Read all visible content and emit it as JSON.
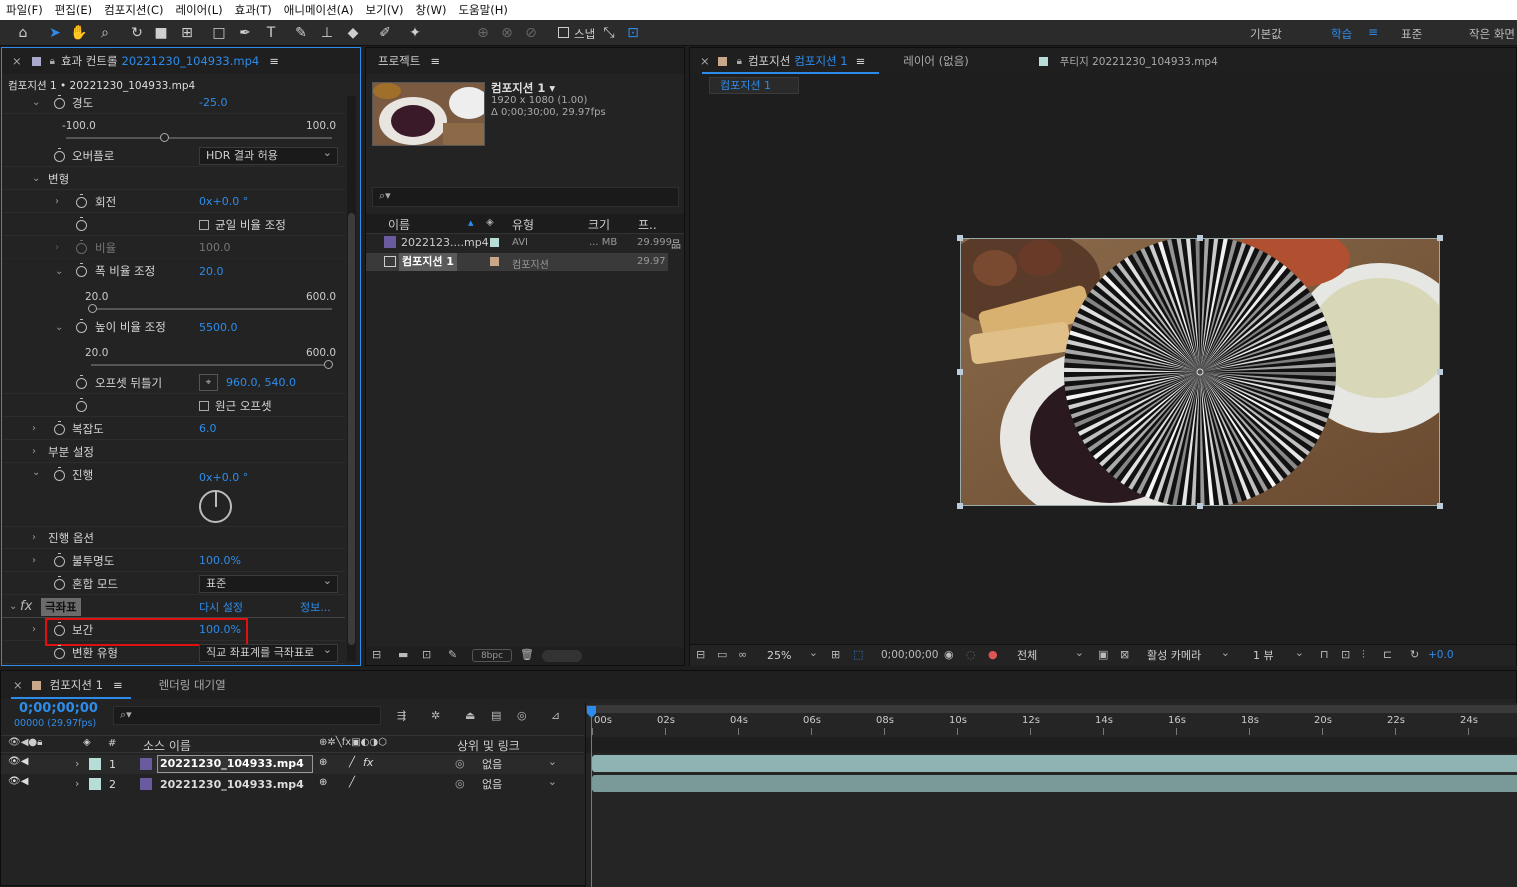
{
  "menu": [
    "파일(F)",
    "편집(E)",
    "컴포지션(C)",
    "레이어(L)",
    "효과(T)",
    "애니메이션(A)",
    "보기(V)",
    "창(W)",
    "도움말(H)"
  ],
  "toolbar": {
    "snap_label": "스냅",
    "workspaces": [
      "기본값",
      "학습",
      "표준",
      "작은 화면"
    ]
  },
  "effects": {
    "tab_title": "효과 컨트롤",
    "tab_file": "20221230_104933.mp4",
    "breadcrumb": "컴포지션 1 • 20221230_104933.mp4",
    "props": {
      "kyungdo": "경도",
      "kyungdo_val": "-25.0",
      "kyungdo_min": "-100.0",
      "kyungdo_max": "100.0",
      "overflow": "오버플로",
      "overflow_val": "HDR 결과 허용",
      "transform": "변형",
      "rotation": "회전",
      "rotation_val": "0x+0.0 °",
      "uniform": "균일 비율 조정",
      "ratio": "비율",
      "ratio_val": "100.0",
      "width_scale": "폭 비율 조정",
      "width_val": "20.0",
      "width_min": "20.0",
      "width_max": "600.0",
      "height_scale": "높이 비율 조정",
      "height_val": "5500.0",
      "height_min": "20.0",
      "height_max": "600.0",
      "offset": "오프셋 뒤틀기",
      "offset_val": "960.0, 540.0",
      "orig_offset": "원근 오프셋",
      "complexity": "복잡도",
      "complexity_val": "6.0",
      "sub": "부분 설정",
      "evolution": "진행",
      "evolution_val": "0x+0.0 °",
      "evo_opt": "진행 옵션",
      "opacity": "불투명도",
      "opacity_val": "100.0%",
      "blend": "혼합 모드",
      "blend_val": "표준",
      "fx_name": "극좌표",
      "reset": "다시 설정",
      "info": "정보...",
      "interp": "보간",
      "interp_val": "100.0%",
      "conv": "변환 유형",
      "conv_val": "직교 좌표계를 극좌표로"
    }
  },
  "project": {
    "tab": "프로젝트",
    "comp_name": "컴포지션 1 ▾",
    "comp_res": "1920 x 1080 (1.00)",
    "comp_dur": "Δ 0;00;30;00, 29.97fps",
    "cols": [
      "이름",
      "유형",
      "크기",
      "프.."
    ],
    "rows": [
      {
        "name": "2022123....mp4",
        "type": "AVI",
        "size": "... MB",
        "fps": "29.999"
      },
      {
        "name": "컴포지션 1",
        "type": "컴포지션",
        "size": "",
        "fps": "29.97"
      }
    ],
    "bpc": "8bpc"
  },
  "viewer": {
    "tab_comp": "컴포지션",
    "tab_comp_name": "컴포지션 1",
    "tab_layer": "레이어 (없음)",
    "tab_footage": "푸티지 20221230_104933.mp4",
    "sub_tab": "컴포지션 1",
    "zoom": "25%",
    "time": "0;00;00;00",
    "res": "전체",
    "camera": "활성 카메라",
    "views": "1 뷰",
    "exposure": "+0.0"
  },
  "timeline": {
    "tab": "컴포지션 1",
    "render_tab": "렌더링 대기열",
    "timecode": "0;00;00;00",
    "frames": "00000 (29.97fps)",
    "col_source": "소스 이름",
    "col_parent": "상위 및 링크",
    "ticks": [
      "00s",
      "02s",
      "04s",
      "06s",
      "08s",
      "10s",
      "12s",
      "14s",
      "16s",
      "18s",
      "20s",
      "22s",
      "24s"
    ],
    "layers": [
      {
        "num": "1",
        "name": "20221230_104933.mp4",
        "parent": "없음"
      },
      {
        "num": "2",
        "name": "20221230_104933.mp4",
        "parent": "없음"
      }
    ]
  },
  "colors": {
    "accent": "#2d8ceb",
    "highlight_box": "#e01010",
    "layer_bar": "#8fb3b3"
  }
}
